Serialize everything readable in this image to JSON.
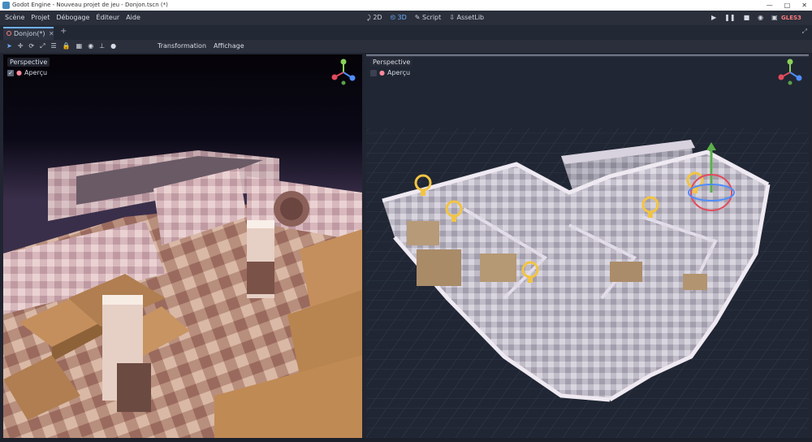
{
  "window": {
    "title": "Godot Engine - Nouveau projet de jeu - Donjon.tscn (*)"
  },
  "menu": {
    "items": [
      "Scène",
      "Projet",
      "Débogage",
      "Éditeur",
      "Aide"
    ]
  },
  "modes": {
    "items": [
      "2D",
      "3D",
      "Script",
      "AssetLib"
    ],
    "active": "3D"
  },
  "run_icons": [
    "play-icon",
    "pause-icon",
    "stop-icon",
    "play-scene-icon",
    "play-custom-scene-icon"
  ],
  "renderer": {
    "label": "GLES3"
  },
  "tabs": [
    {
      "label": "Donjon(*)"
    }
  ],
  "toolbar": {
    "menus": [
      "Transformation",
      "Affichage"
    ]
  },
  "viewports": {
    "left": {
      "mode": "Perspective",
      "preview": "Aperçu",
      "preview_checked": true
    },
    "right": {
      "mode": "Perspective",
      "preview": "Aperçu",
      "preview_checked": false
    }
  },
  "colors": {
    "accent": "#6fb0ff",
    "panel": "#2a2f3b",
    "background": "#202531",
    "renderer": "#ff7a7a"
  }
}
